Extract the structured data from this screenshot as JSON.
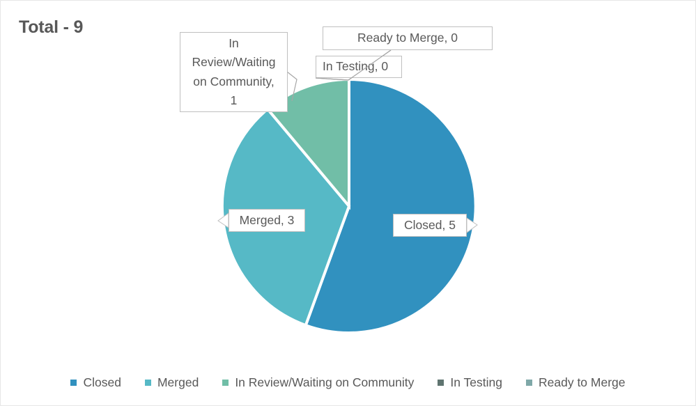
{
  "chart_title": "Total - 9",
  "colors": {
    "closed": "#3191bf",
    "merged": "#56b9c6",
    "in_review": "#71bea7",
    "in_testing": "#5f7470",
    "ready_to_merge": "#7fa8a8",
    "label_text": "#595959",
    "label_border": "#bfbfbf",
    "leader_line": "#a6a6a6",
    "card_border": "#e6e6e6",
    "title_text": "#585858",
    "background": "#ffffff"
  },
  "data_labels": {
    "closed": "Closed, 5",
    "merged": "Merged, 3",
    "in_review": "In\nReview/Waiting\non Community,\n1",
    "ready_to_merge": "Ready to Merge, 0",
    "in_testing": "In Testing, 0"
  },
  "legend": {
    "items": [
      {
        "label": "Closed",
        "color": "#3191bf"
      },
      {
        "label": "Merged",
        "color": "#56b9c6"
      },
      {
        "label": "In Review/Waiting on Community",
        "color": "#71bea7"
      },
      {
        "label": "In Testing",
        "color": "#5f7470"
      },
      {
        "label": "Ready to Merge",
        "color": "#7fa8a8"
      }
    ]
  },
  "chart_data": {
    "type": "pie",
    "title": "Total - 9",
    "total": 9,
    "categories": [
      "Closed",
      "Merged",
      "In Review/Waiting on Community",
      "In Testing",
      "Ready to Merge"
    ],
    "values": [
      5,
      3,
      1,
      0,
      0
    ],
    "percentages": [
      55.6,
      33.3,
      11.1,
      0,
      0
    ],
    "labels": [
      "Closed, 5",
      "Merged, 3",
      "In Review/Waiting on Community, 1",
      "In Testing, 0",
      "Ready to Merge, 0"
    ],
    "colors": [
      "#3191bf",
      "#56b9c6",
      "#71bea7",
      "#5f7470",
      "#7fa8a8"
    ],
    "start_angle_deg": 0,
    "direction": "clockwise",
    "legend_position": "bottom",
    "grid": false,
    "data_labels_shown": true,
    "xlabel": "",
    "ylabel": ""
  }
}
